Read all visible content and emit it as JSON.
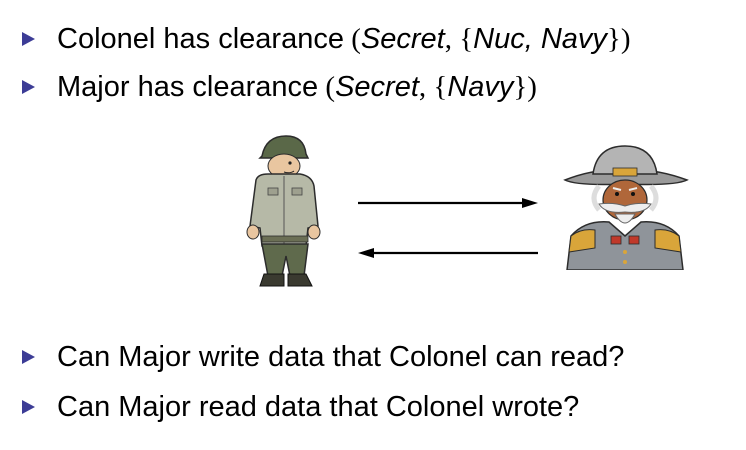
{
  "bullets_top": [
    {
      "subject": "Colonel has clearance",
      "level": "Secret",
      "categories": "Nuc, Navy"
    },
    {
      "subject": "Major has clearance",
      "level": "Secret",
      "categories": "Navy"
    }
  ],
  "bullets_bottom": [
    {
      "text": "Can Major write data that Colonel can read?"
    },
    {
      "text": "Can Major read data that Colonel wrote?"
    }
  ],
  "colors": {
    "bullet": "#3c3c96",
    "text": "#000000",
    "arrow": "#000000"
  },
  "icons": {
    "major": "soldier-cartoon-icon",
    "colonel": "general-cartoon-icon"
  }
}
